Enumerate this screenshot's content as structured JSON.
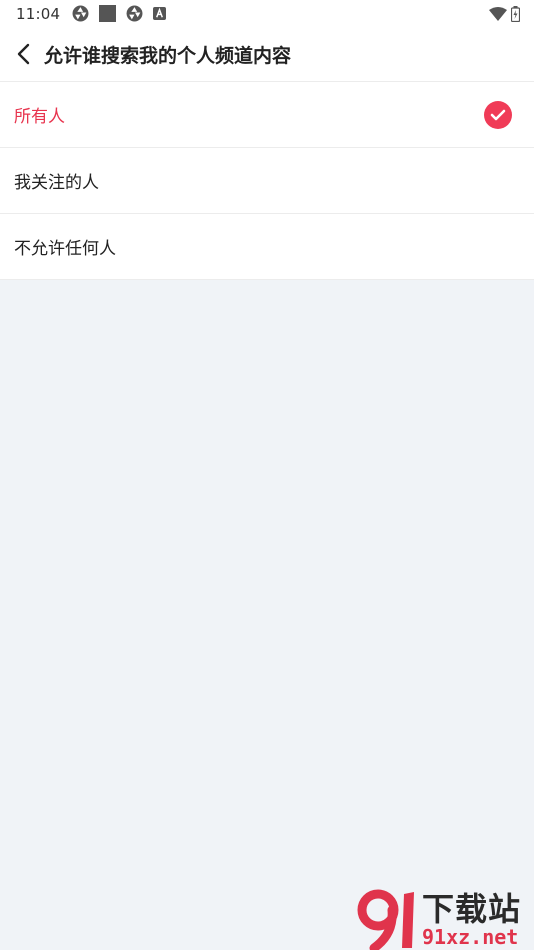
{
  "status_bar": {
    "time": "11:04"
  },
  "header": {
    "title": "允许谁搜索我的个人频道内容"
  },
  "options": [
    {
      "label": "所有人",
      "selected": true
    },
    {
      "label": "我关注的人",
      "selected": false
    },
    {
      "label": "不允许任何人",
      "selected": false
    }
  ],
  "watermark": {
    "logo_text": "91",
    "cn_text": "下载站",
    "url_text": "91xz.net"
  },
  "colors": {
    "accent": "#e8344e",
    "background": "#f0f3f7"
  }
}
